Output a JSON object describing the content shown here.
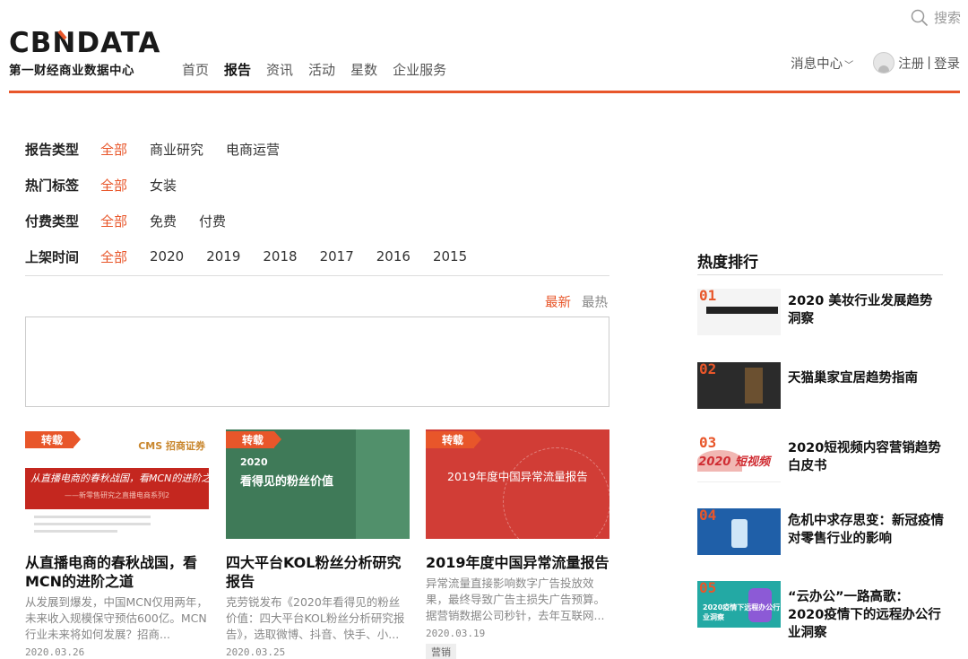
{
  "header": {
    "search_label": "搜索",
    "logo_text": "CBNDATA",
    "logo_sub": "第一财经商业数据中心",
    "nav": [
      {
        "label": "首页",
        "active": false
      },
      {
        "label": "报告",
        "active": true
      },
      {
        "label": "资讯",
        "active": false
      },
      {
        "label": "活动",
        "active": false
      },
      {
        "label": "星数",
        "active": false
      },
      {
        "label": "企业服务",
        "active": false
      }
    ],
    "message_center": "消息中心",
    "register": "注册",
    "separator": "|",
    "login": "登录",
    "accent_color": "#e8562a"
  },
  "filters": [
    {
      "label": "报告类型",
      "options": [
        "全部",
        "商业研究",
        "电商运营"
      ],
      "selected": 0
    },
    {
      "label": "热门标签",
      "options": [
        "全部",
        "女装"
      ],
      "selected": 0
    },
    {
      "label": "付费类型",
      "options": [
        "全部",
        "免费",
        "付费"
      ],
      "selected": 0
    },
    {
      "label": "上架时间",
      "options": [
        "全部",
        "2020",
        "2019",
        "2018",
        "2017",
        "2016",
        "2015"
      ],
      "selected": 0
    }
  ],
  "sort": {
    "newest": "最新",
    "hottest": "最热"
  },
  "cards": [
    {
      "tag": "转载",
      "thumb_band_text": "从直播电商的春秋战国，看MCN的进阶之道",
      "thumb_band_sub": "——新零售研究之直播电商系列2",
      "thumb_brand": "CMS 招商证券",
      "title": "从直播电商的春秋战国，看MCN的进阶之道",
      "desc": "从发展到爆发，中国MCN仅用两年，未来收入规模保守预估600亿。MCN行业未来将如何发展？招商...",
      "date": "2020.03.26"
    },
    {
      "tag": "转载",
      "thumb_year": "2020",
      "thumb_title": "看得见的粉丝价值",
      "title": "四大平台KOL粉丝分析研究报告",
      "desc": "克劳锐发布《2020年看得见的粉丝价值：四大平台KOL粉丝分析研究报告》，选取微博、抖音、快手、小...",
      "date": "2020.03.25"
    },
    {
      "tag": "转载",
      "thumb_title": "2019年度中国异常流量报告",
      "title": "2019年度中国异常流量报告",
      "desc": "异常流量直接影响数字广告投放效果，最终导致广告主损失广告预算。据营销数据公司秒针，去年互联网...",
      "date": "2020.03.19",
      "label": "营销"
    }
  ],
  "sidebar": {
    "heading": "热度排行",
    "items": [
      {
        "rank": "01",
        "title": "2020 美妆行业发展趋势洞察"
      },
      {
        "rank": "02",
        "title": "天猫巢家宜居趋势指南"
      },
      {
        "rank": "03",
        "title": "2020短视频内容营销趋势白皮书",
        "thumb_text": "2020 短视频"
      },
      {
        "rank": "04",
        "title": "危机中求存思变：新冠疫情对零售行业的影响"
      },
      {
        "rank": "05",
        "title": "“云办公”一路高歌：2020疫情下的远程办公行业洞察",
        "thumb_text": "2020疫情下远程办公行业洞察"
      }
    ]
  }
}
